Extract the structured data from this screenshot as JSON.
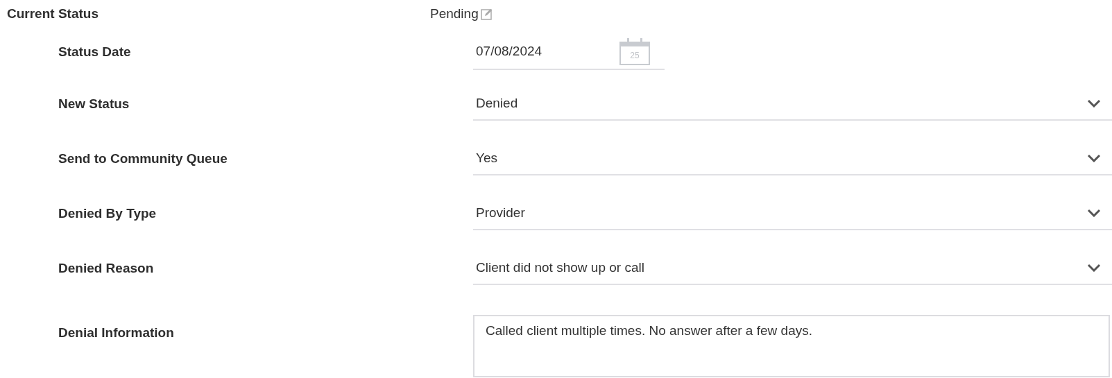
{
  "current_status": {
    "label": "Current Status",
    "value": "Pending"
  },
  "fields": [
    {
      "kind": "date",
      "label": "Status Date",
      "value": "07/08/2024",
      "calendar_day": "25"
    },
    {
      "kind": "select",
      "label": "New Status",
      "value": "Denied"
    },
    {
      "kind": "select",
      "label": "Send to Community Queue",
      "value": "Yes"
    },
    {
      "kind": "select",
      "label": "Denied By Type",
      "value": "Provider"
    },
    {
      "kind": "select",
      "label": "Denied Reason",
      "value": "Client did not show up or call"
    },
    {
      "kind": "textarea",
      "label": "Denial Information",
      "value": "Called client multiple times. No answer after a few days."
    }
  ]
}
